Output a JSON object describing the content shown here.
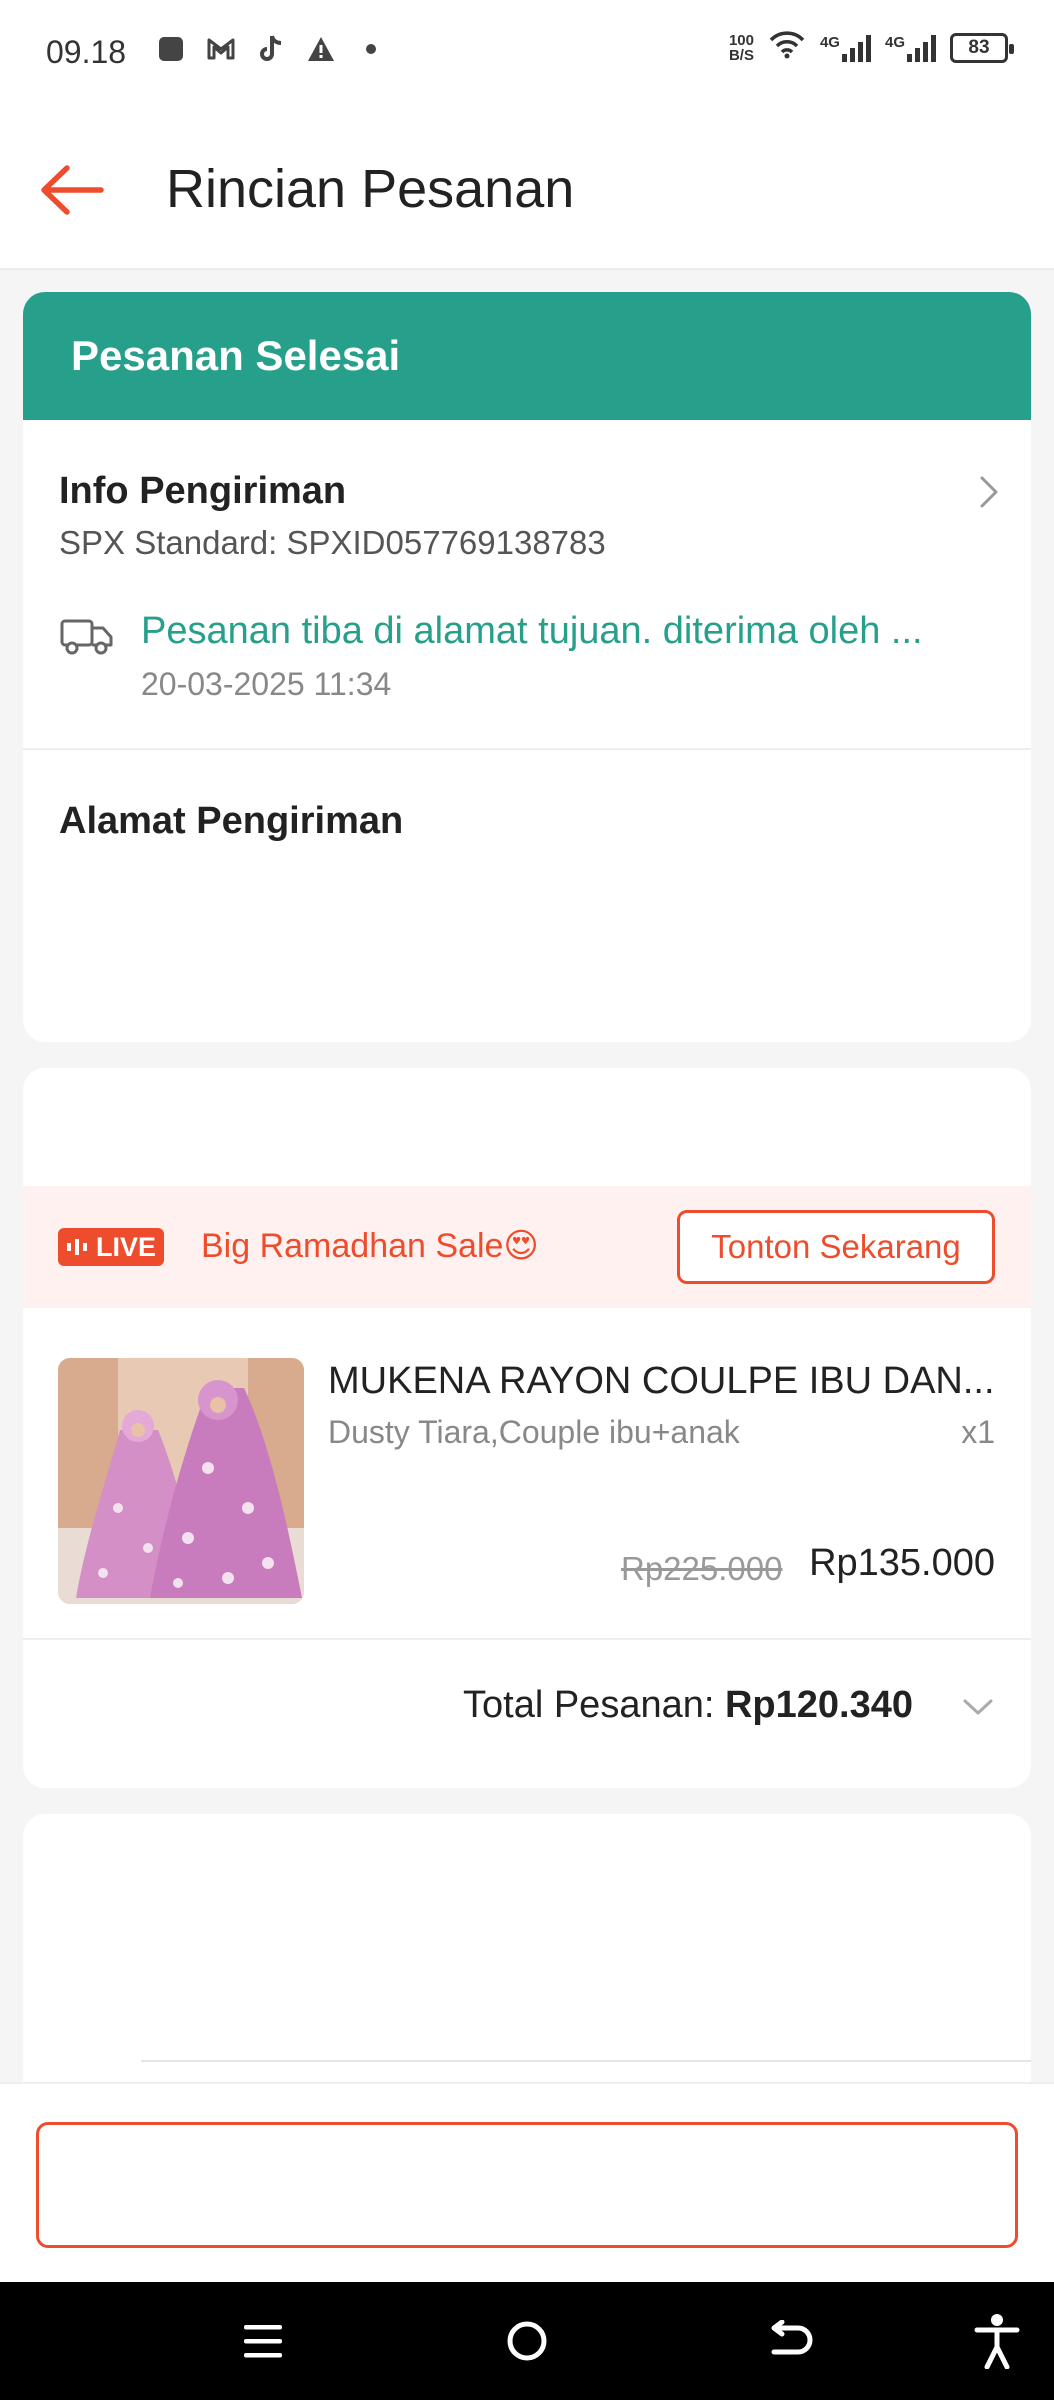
{
  "status_bar": {
    "time": "09.18",
    "net_speed_top": "100",
    "net_speed_bottom": "B/S",
    "net1": "4G",
    "net2": "4G",
    "battery": "83"
  },
  "header": {
    "title": "Rincian Pesanan"
  },
  "order_status": {
    "label": "Pesanan Selesai",
    "color": "#26a08b"
  },
  "shipping_info": {
    "title": "Info Pengiriman",
    "tracking": "SPX Standard: SPXID057769138783",
    "status": "Pesanan tiba di alamat tujuan. diterima oleh ...",
    "timestamp": "20-03-2025 11:34"
  },
  "address": {
    "title": "Alamat Pengiriman"
  },
  "live": {
    "badge": "LIVE",
    "text": "Big Ramadhan Sale😍",
    "button": "Tonton Sekarang",
    "accent": "#ee4d2d"
  },
  "product": {
    "name": "MUKENA RAYON COULPE IBU DAN...",
    "variant": "Dusty Tiara,Couple ibu+anak",
    "qty": "x1",
    "price_original": "Rp225.000",
    "price": "Rp135.000"
  },
  "total": {
    "label": "Total Pesanan:",
    "value": "Rp120.340"
  }
}
